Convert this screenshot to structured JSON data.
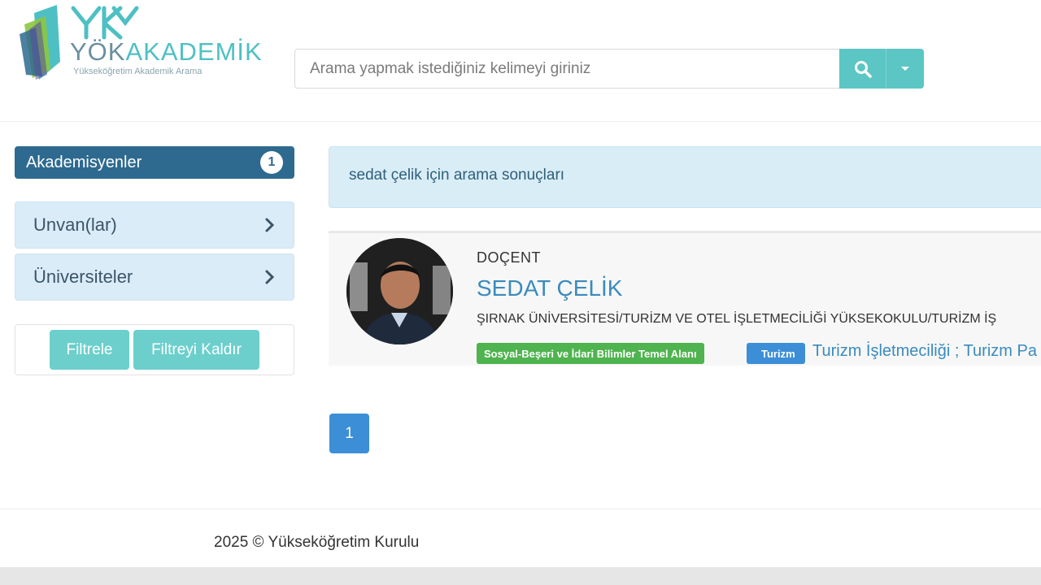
{
  "brand": {
    "logo_mark": "YÖK",
    "title_a": "YÖK",
    "title_b": "AKADEMİK",
    "subtitle": "Yükseköğretim Akademik Arama"
  },
  "search": {
    "placeholder": "Arama yapmak istediğiniz kelimeyi giriniz",
    "value": "",
    "search_icon": "search-icon",
    "dropdown_icon": "caret-down-icon"
  },
  "sidebar": {
    "header_label": "Akademisyenler",
    "header_count": "1",
    "filters": [
      {
        "label": "Unvan(lar)"
      },
      {
        "label": "Üniversiteler"
      }
    ],
    "filter_button": "Filtrele",
    "clear_button": "Filtreyi Kaldır"
  },
  "results": {
    "info_text": "sedat çelik için arama sonuçları",
    "items": [
      {
        "title": "DOÇENT",
        "name": "SEDAT ÇELİK",
        "institution": "ŞIRNAK ÜNİVERSİTESİ/TURİZM VE OTEL İŞLETMECİLİĞİ YÜKSEKOKULU/TURİZM İŞ",
        "field_tag": "Sosyal-Beşeri ve İdari Bilimler Temel Alanı",
        "area_tag": "Turizm",
        "keywords": "Turizm İşletmeciliği ; Turizm Pa"
      }
    ]
  },
  "pagination": {
    "current_page": "1"
  },
  "footer": {
    "text": "2025 © Yükseköğretim Kurulu"
  },
  "colors": {
    "accent": "#5bc6c4",
    "sidebar_header": "#2e6a8f",
    "link": "#3a8bbd",
    "tag_green": "#4fb34f",
    "tag_blue": "#3c8ed6"
  }
}
